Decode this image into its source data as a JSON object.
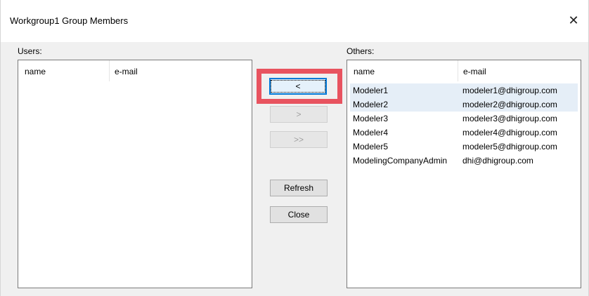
{
  "window": {
    "title": "Workgroup1 Group Members",
    "close_glyph": "✕"
  },
  "users_panel": {
    "label": "Users:",
    "columns": [
      "name",
      "e-mail"
    ],
    "rows": []
  },
  "others_panel": {
    "label": "Others:",
    "columns": [
      "name",
      "e-mail"
    ],
    "rows": [
      {
        "name": "Modeler1",
        "email": "modeler1@dhigroup.com",
        "selected": true
      },
      {
        "name": "Modeler2",
        "email": "modeler2@dhigroup.com",
        "selected": true
      },
      {
        "name": "Modeler3",
        "email": "modeler3@dhigroup.com",
        "selected": false
      },
      {
        "name": "Modeler4",
        "email": "modeler4@dhigroup.com",
        "selected": false
      },
      {
        "name": "Modeler5",
        "email": "modeler5@dhigroup.com",
        "selected": false
      },
      {
        "name": "ModelingCompanyAdmin",
        "email": "dhi@dhigroup.com",
        "selected": false
      }
    ]
  },
  "buttons": {
    "move_left": "<",
    "move_right": ">",
    "move_all_right": ">>",
    "refresh": "Refresh",
    "close": "Close"
  },
  "colors": {
    "highlight": "#e8535f",
    "selection": "#e5eef7",
    "focus": "#0078d7"
  }
}
